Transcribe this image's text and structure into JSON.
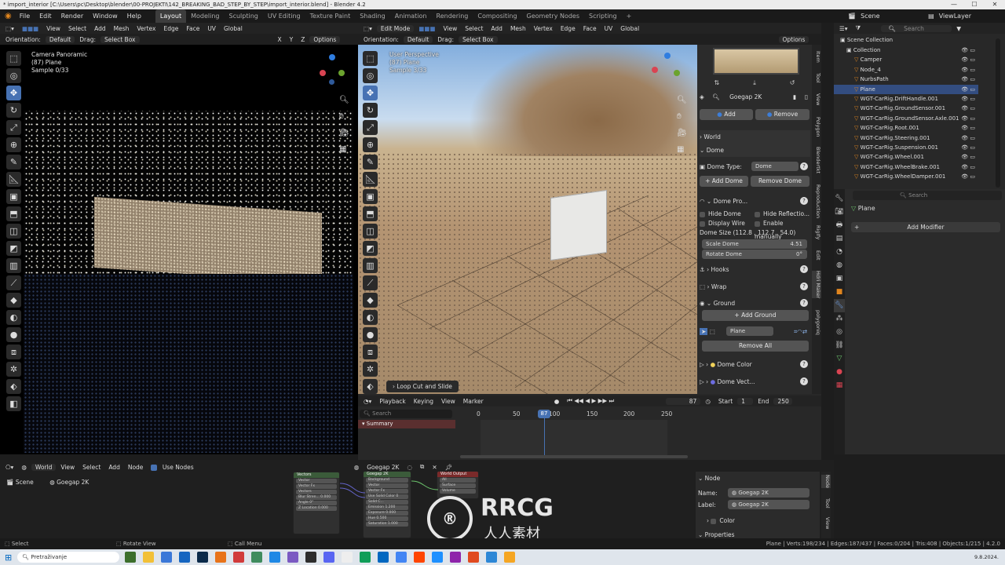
{
  "window": {
    "title": "* import_interior [C:\\Users\\pc\\Desktop\\blender\\00-PROJEKTI\\142_BREAKING_BAD_STEP_BY_STEP\\import_interior.blend] - Blender 4.2",
    "controls": [
      "—",
      "☐",
      "✕"
    ]
  },
  "menu": {
    "items": [
      "File",
      "Edit",
      "Render",
      "Window",
      "Help"
    ],
    "workspaces": [
      "Layout",
      "Modeling",
      "Sculpting",
      "UV Editing",
      "Texture Paint",
      "Shading",
      "Animation",
      "Rendering",
      "Compositing",
      "Geometry Nodes",
      "Scripting"
    ],
    "active_workspace": "Layout",
    "add_tab": "+",
    "scene_label": "Scene",
    "viewlayer_label": "ViewLayer"
  },
  "left_viewport": {
    "header": [
      "View",
      "Select",
      "Add",
      "Mesh",
      "Vertex",
      "Edge",
      "Face",
      "UV"
    ],
    "transform": "Global",
    "orientation_label": "Orientation:",
    "orientation_value": "Default",
    "drag_label": "Drag:",
    "drag_value": "Select Box",
    "axes": [
      "X",
      "Y",
      "Z"
    ],
    "options": "Options",
    "overlay": [
      "Camera Panoramic",
      "(87) Plane",
      "Sample 0/33"
    ]
  },
  "main_viewport": {
    "mode": "Edit Mode",
    "header": [
      "View",
      "Select",
      "Add",
      "Mesh",
      "Vertex",
      "Edge",
      "Face",
      "UV"
    ],
    "transform": "Global",
    "orientation_label": "Orientation:",
    "orientation_value": "Default",
    "drag_label": "Drag:",
    "drag_value": "Select Box",
    "options": "Options",
    "overlay": [
      "User Perspective",
      "(87) Plane",
      "Sample 3/33"
    ],
    "last_op": "Loop Cut and Slide"
  },
  "n_panel": {
    "tabs": [
      "Item",
      "Tool",
      "View",
      "Polygon",
      "Blendertkt",
      "Reproduction",
      "RigIfy",
      "Edit",
      "Hdri Maker",
      "polygoniq"
    ],
    "hdri_name": "Goegap 2K",
    "add": "Add",
    "remove": "Remove",
    "world": "World",
    "dome": "Dome",
    "dome_type_label": "Dome Type:",
    "dome_type": "Dome",
    "add_dome": "Add Dome",
    "remove_dome": "Remove Dome",
    "dome_pro": "Dome Pro...",
    "hide_dome": "Hide Dome",
    "hide_reflection": "Hide Reflectio...",
    "display_wire": "Display Wire",
    "enable_manually": "Enable manually",
    "dome_size": "Dome Size (112.8 , 112.7 , 54.0)",
    "scale_dome_label": "Scale Dome",
    "scale_dome": "4.51",
    "rotate_dome_label": "Rotate Dome",
    "rotate_dome": "0°",
    "hooks": "Hooks",
    "wrap": "Wrap",
    "ground": "Ground",
    "add_ground": "Add Ground",
    "ground_object": "Plane",
    "remove_all": "Remove All",
    "dome_color": "Dome Color",
    "dome_vector": "Dome Vect..."
  },
  "outliner": {
    "search_placeholder": "Search",
    "root": "Scene Collection",
    "items": [
      {
        "name": "Collection",
        "depth": 0
      },
      {
        "name": "Camper",
        "depth": 1
      },
      {
        "name": "Node_4",
        "depth": 1
      },
      {
        "name": "NurbsPath",
        "depth": 1
      },
      {
        "name": "Plane",
        "depth": 1,
        "selected": true
      },
      {
        "name": "WGT-CarRig.DriftHandle.001",
        "depth": 1
      },
      {
        "name": "WGT-CarRig.GroundSensor.001",
        "depth": 1
      },
      {
        "name": "WGT-CarRig.GroundSensor.Axle.001",
        "depth": 1
      },
      {
        "name": "WGT-CarRig.Root.001",
        "depth": 1
      },
      {
        "name": "WGT-CarRig.Steering.001",
        "depth": 1
      },
      {
        "name": "WGT-CarRig.Suspension.001",
        "depth": 1
      },
      {
        "name": "WGT-CarRig.Wheel.001",
        "depth": 1
      },
      {
        "name": "WGT-CarRig.WheelBrake.001",
        "depth": 1
      },
      {
        "name": "WGT-CarRig.WheelDamper.001",
        "depth": 1
      }
    ]
  },
  "properties": {
    "search_placeholder": "Search",
    "object": "Plane",
    "add_modifier": "Add Modifier"
  },
  "timeline": {
    "menu": [
      "Playback",
      "Keying",
      "View",
      "Marker"
    ],
    "current_frame": "87",
    "start_label": "Start",
    "start": "1",
    "end_label": "End",
    "end": "250",
    "search_placeholder": "Search",
    "summary": "Summary",
    "ticks": [
      "0",
      "50",
      "100",
      "150",
      "200",
      "250"
    ],
    "playhead": "87"
  },
  "node_editor": {
    "world_label": "World",
    "menu": [
      "View",
      "Select",
      "Add",
      "Node"
    ],
    "use_nodes": "Use Nodes",
    "node_name": "Goegap 2K",
    "breadcrumb": [
      "Scene",
      "Goegap 2K"
    ],
    "nodes": {
      "vectors": {
        "title": "Vectors",
        "rows": [
          "Vector",
          "Vector Fx",
          "Vectors",
          "Blur Stren... 0.000",
          "Angle 0°",
          "Z Location 0.000"
        ]
      },
      "goegap": {
        "title": "Goegap 2K",
        "rows": [
          "Background",
          "Vector",
          "Vector Fx",
          "Use Solid Color 0",
          "Solid C...",
          "Emission 1.200",
          "Exposure 0.000",
          "Hue 0.500",
          "Saturation 1.000"
        ]
      },
      "output": {
        "title": "World Output",
        "rows": [
          "All",
          "Surface",
          "Volume"
        ]
      }
    },
    "side_node_title": "Node",
    "name_label": "Name:",
    "name_value": "Goegap 2K",
    "label_label": "Label:",
    "label_value": "Goegap 2K",
    "color": "Color",
    "properties": "Properties",
    "side_tabs": [
      "Node",
      "Tool",
      "View"
    ]
  },
  "statusbar": {
    "left": [
      "Select",
      "Rotate View",
      "Call Menu"
    ],
    "right": "Plane | Verts:198/234 | Edges:187/437 | Faces:0/204 | Tris:408 | Objects:1/215 | 4.2.0"
  },
  "taskbar": {
    "search_placeholder": "Pretraživanje",
    "time": "9.8.2024.",
    "app_colors": [
      "#3c6e2c",
      "#f2c037",
      "#3b78d8",
      "#1565c0",
      "#0b2a4a",
      "#e8731a",
      "#d13b3b",
      "#3f8c5e",
      "#1e88e5",
      "#7b5ac2",
      "#2d2d2d",
      "#5865f2",
      "#eeeeee",
      "#0f9d58",
      "#0067c0",
      "#4285f4",
      "#ff4500",
      "#1e90ff",
      "#8e24aa",
      "#e04a1f",
      "#2d87d6",
      "#f5a623"
    ]
  },
  "watermark": {
    "brand": "RRCG",
    "sub": "人人素材"
  }
}
